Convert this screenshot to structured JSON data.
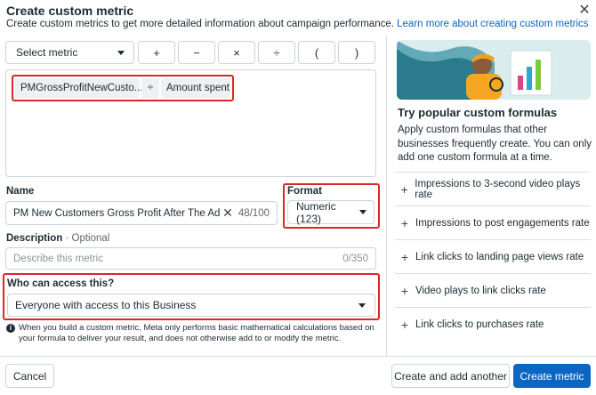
{
  "dialog": {
    "title": "Create custom metric",
    "subtitle": "Create custom metrics to get more detailed information about campaign performance.",
    "learn_more": "Learn more about creating custom metrics",
    "close_icon": "close-icon"
  },
  "formula_builder": {
    "select_metric_label": "Select metric",
    "operators": [
      "+",
      "−",
      "×",
      "÷",
      "(",
      ")"
    ],
    "chips": {
      "metric_1": "PMGrossProfitNewCusto...",
      "operator": "÷",
      "metric_2": "Amount spent"
    }
  },
  "name": {
    "label": "Name",
    "value": "PM New Customers Gross Profit After The Ad Spend",
    "count": "48/100"
  },
  "format": {
    "label": "Format",
    "value": "Numeric (123)"
  },
  "description": {
    "label": "Description",
    "optional": "Optional",
    "placeholder": "Describe this metric",
    "count": "0/350"
  },
  "access": {
    "label": "Who can access this?",
    "value": "Everyone with access to this Business"
  },
  "info_note": "When you build a custom metric, Meta only performs basic mathematical calculations based on your formula to deliver your result, and does not otherwise add to or modify the metric.",
  "popular": {
    "title": "Try popular custom formulas",
    "description": "Apply custom formulas that other businesses frequently create. You can only add one custom formula at a time.",
    "items": [
      "Impressions to 3-second video plays rate",
      "Impressions to post engagements rate",
      "Link clicks to landing page views rate",
      "Video plays to link clicks rate",
      "Link clicks to purchases rate"
    ]
  },
  "footer": {
    "cancel": "Cancel",
    "create_another": "Create and add another",
    "create": "Create metric"
  },
  "colors": {
    "accent": "#0a66c2",
    "highlight": "#e0242a"
  }
}
